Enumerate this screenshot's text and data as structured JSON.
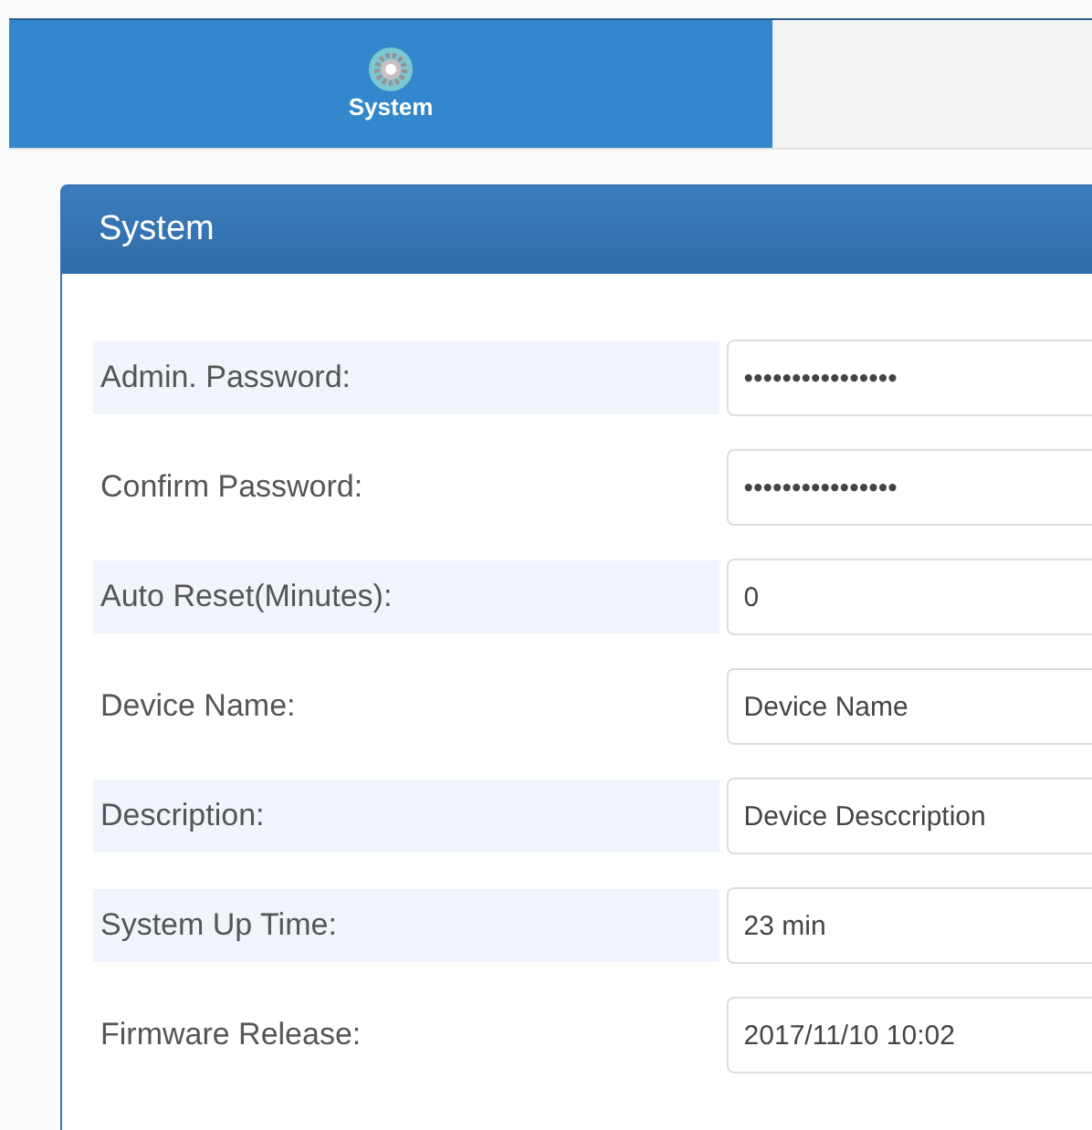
{
  "nav": [
    {
      "label": "System",
      "selected": true
    }
  ],
  "panel": {
    "title": "System",
    "fields": [
      {
        "label": "Admin. Password:",
        "value": "••••••••••••••••",
        "highlighted": true
      },
      {
        "label": "Confirm Password:",
        "value": "••••••••••••••••",
        "highlighted": false
      },
      {
        "label": "Auto Reset(Minutes):",
        "value": "0",
        "highlighted": true
      },
      {
        "label": "Device Name:",
        "value": "Device Name",
        "highlighted": false
      },
      {
        "label": "Description:",
        "value": "Device Desccription",
        "highlighted": true
      },
      {
        "label": "System Up Time:",
        "value": "23 min",
        "highlighted": true
      },
      {
        "label": "Firmware Release:",
        "value": "2017/11/10 10:02",
        "highlighted": false
      }
    ]
  }
}
